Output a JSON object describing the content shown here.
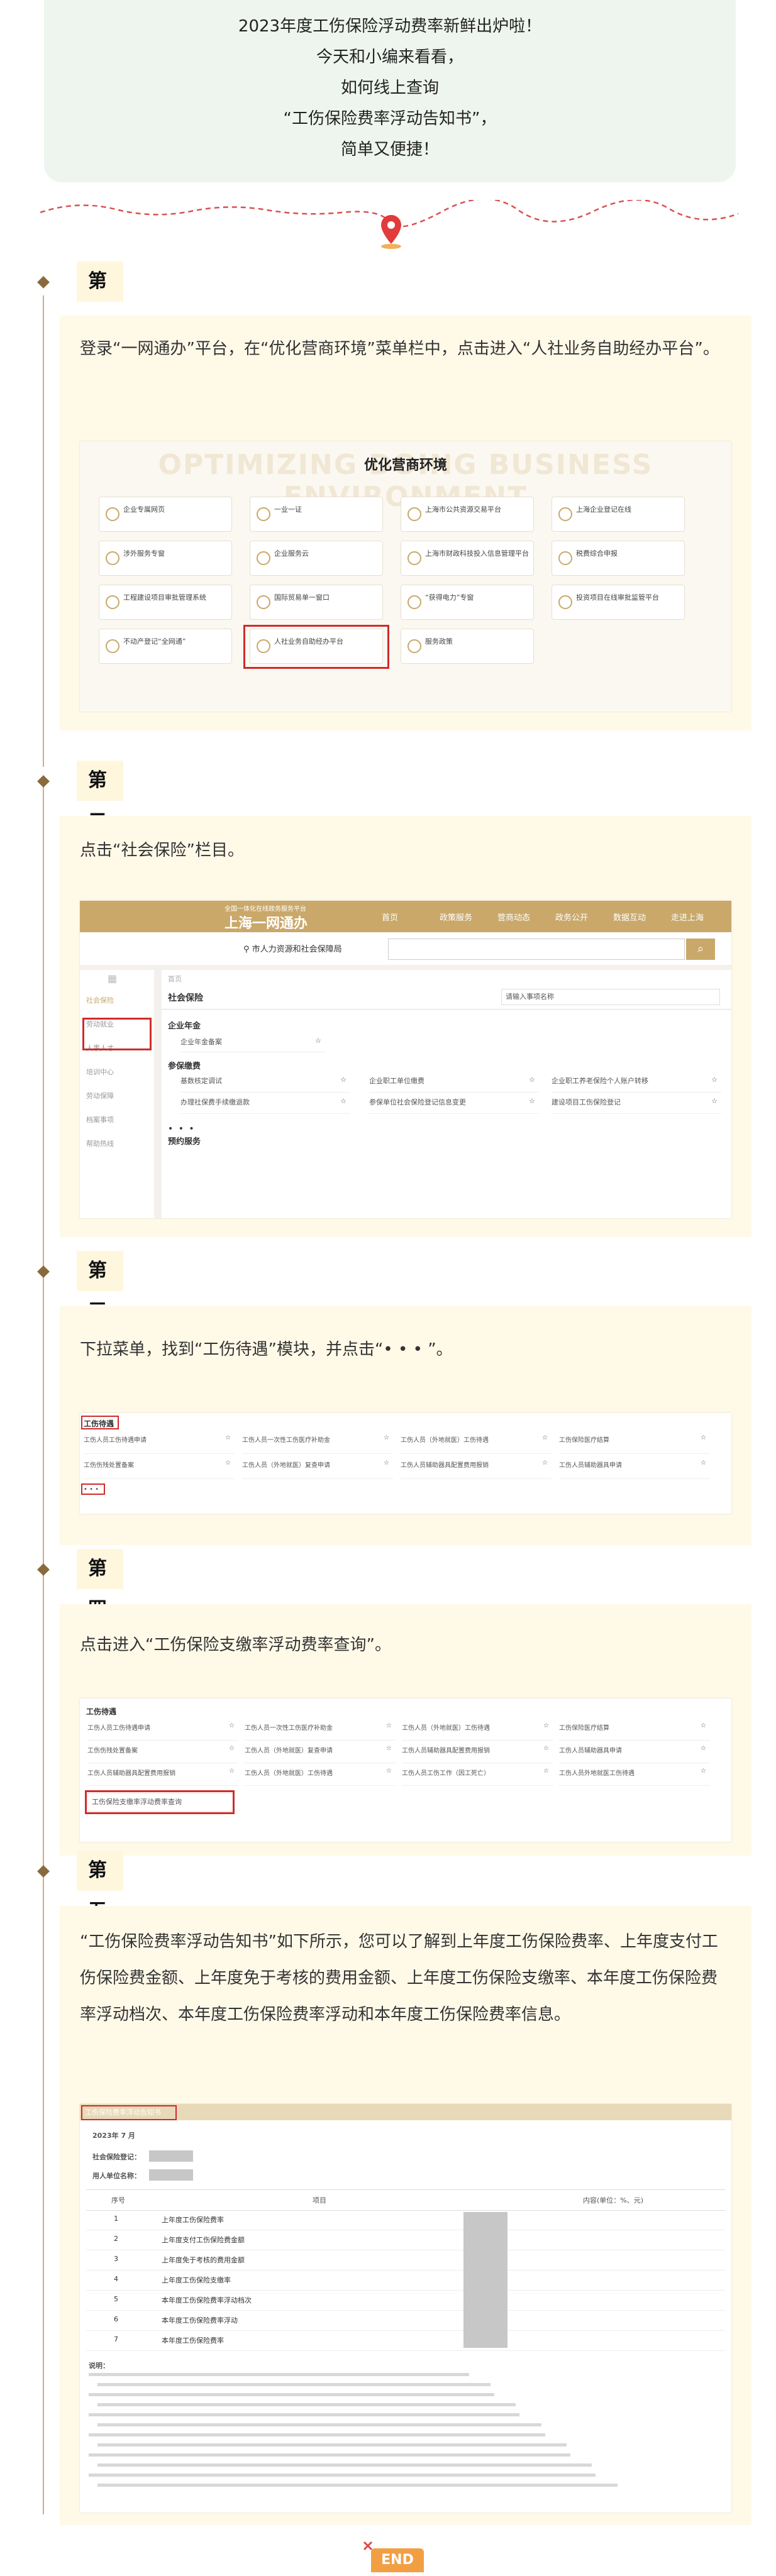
{
  "intro": {
    "lines": [
      "2023年度工伤保险浮动费率新鲜出炉啦！",
      "今天和小编来看看，",
      "如何线上查询",
      "“工伤保险费率浮动告知书”，",
      "简单又便捷！"
    ]
  },
  "steps": [
    {
      "title": "第一步",
      "text": "登录“一网通办”平台，在“优化营商环境”菜单栏中，点击进入“人社业务自助经办平台”。"
    },
    {
      "title": "第二步",
      "text": "点击“社会保险”栏目。"
    },
    {
      "title": "第三步",
      "text": "下拉菜单，找到“工伤待遇”模块，并点击“• • • ”。"
    },
    {
      "title": "第四步",
      "text": "点击进入“工伤保险支缴率浮动费率查询”。"
    },
    {
      "title": "第五步",
      "text": "“工伤保险费率浮动告知书”如下所示，您可以了解到上年度工伤保险费率、上年度支付工伤保险费金额、上年度免于考核的费用金额、上年度工伤保险支缴率、本年度工伤保险费率浮动档次、本年度工伤保险费率浮动和本年度工伤保险费率信息。"
    }
  ],
  "shot1": {
    "watermark": "OPTIMIZING DOING BUSINESS ENVIRONMENT",
    "heading": "优化营商环境",
    "items": [
      "企业专属网页",
      "一业一证",
      "上海市公共资源交易平台",
      "上海企业登记在线",
      "涉外服务专窗",
      "企业服务云",
      "上海市财政科技投入信息管理平台",
      "税费综合申报",
      "工程建设项目审批管理系统",
      "国际贸易单一窗口",
      "“获得电力”专窗",
      "投资项目在线审批监管平台",
      "不动产登记“全网通”",
      "人社业务自助经办平台",
      "服务政策"
    ]
  },
  "shot2": {
    "logo_small": "全国一体化在线政务服务平台",
    "logo": "上海一网通办",
    "nav": [
      "首页",
      "政策服务",
      "营商动态",
      "政务公开",
      "数据互动",
      "走进上海"
    ],
    "dept": "市人力资源和社会保障局",
    "search_icon": "search-icon",
    "side": [
      "社会保险",
      "劳动就业",
      "人事人才",
      "培训中心",
      "劳动保障",
      "档案事项",
      "帮助热线"
    ],
    "crumb": "首页",
    "section": "社会保险",
    "search_placeholder": "请输入事项名称",
    "groups": [
      {
        "name": "企业年金",
        "items": [
          "企业年金备案"
        ]
      },
      {
        "name": "参保缴费",
        "items": [
          "基数核定调试",
          "企业职工单位缴费",
          "企业职工养老保险个人账户转移",
          "办理社保费手续缴退款",
          "参保单位社会保险登记信息变更",
          "建设项目工伤保险登记"
        ]
      }
    ],
    "more": "• • •",
    "section2": "预约服务"
  },
  "shot3": {
    "module": "工伤待遇",
    "items": [
      "工伤人员工伤待遇申请",
      "工伤人员一次性工伤医疗补助金",
      "工伤人员（外地就医）工伤待遇",
      "工伤保险医疗结算",
      "工伤伤残处置备案",
      "工伤人员（外地就医）复查申请",
      "工伤人员辅助器具配置费用报销",
      "工伤人员辅助器具申请"
    ],
    "more": "• • •"
  },
  "shot4": {
    "module": "工伤待遇",
    "items": [
      "工伤人员工伤待遇申请",
      "工伤人员一次性工伤医疗补助金",
      "工伤人员（外地就医）工伤待遇",
      "工伤保险医疗结算",
      "工伤伤残处置备案",
      "工伤人员（外地就医）复查申请",
      "工伤人员辅助器具配置费用报销",
      "工伤人员辅助器具申请",
      "工伤人员辅助器具配置费用报销",
      "工伤人员（外地就医）工伤待遇",
      "工伤人员工伤工作（因工死亡）",
      "工伤人员外地就医工伤待遇"
    ],
    "highlight": "工伤保险支缴率浮动费率查询"
  },
  "shot5": {
    "title_bar": "工伤保险费率浮动告知书",
    "date": "2023年 7 月",
    "reg_label": "社会保险登记：",
    "name_label": "用人单位名称：",
    "col_no": "序号",
    "col_item": "项目",
    "col_value": "内容(单位：%、元)",
    "rows": [
      "上年度工伤保险费率",
      "上年度支付工伤保险费金额",
      "上年度免于考核的费用金额",
      "上年度工伤保险支缴率",
      "本年度工伤保险费率浮动档次",
      "本年度工伤保险费率浮动",
      "本年度工伤保险费率"
    ],
    "note_label": "说明："
  },
  "end": "END",
  "colors": {
    "accent_red": "#cf2b2b",
    "card_bg": "#fff9e8",
    "gold": "#c9a86a"
  }
}
